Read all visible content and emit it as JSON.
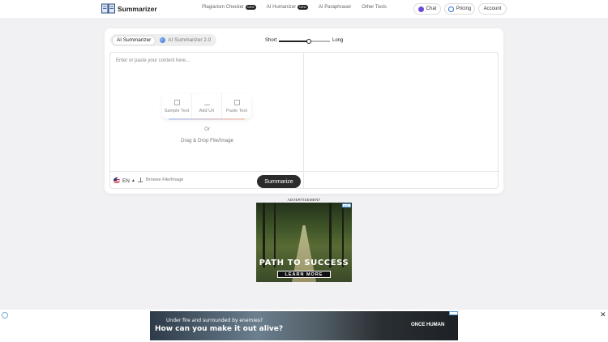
{
  "header": {
    "logo_text": "Summarizer",
    "nav": [
      {
        "label": "Plagiarism Checker",
        "badge": "NEW"
      },
      {
        "label": "AI Humanizer",
        "badge": "NEW"
      },
      {
        "label": "AI Paraphraser",
        "badge": ""
      },
      {
        "label": "Other Tools",
        "badge": ""
      }
    ],
    "chat_label": "Chat",
    "pricing_label": "Pricing",
    "account_label": "Account"
  },
  "tabs": [
    {
      "label": "AI Summarizer",
      "active": true
    },
    {
      "label": "AI Summarizer 2.0",
      "active": false
    }
  ],
  "length": {
    "short_label": "Short",
    "long_label": "Long",
    "level": 0.58
  },
  "editor": {
    "placeholder": "Enter or paste your content here...",
    "actions": [
      {
        "label": "Sample Text",
        "icon": "edit-icon"
      },
      {
        "label": "Add Url",
        "icon": "upload-icon"
      },
      {
        "label": "Paste Text",
        "icon": "clipboard-icon"
      }
    ],
    "or_text": "Or",
    "drag_text": "Drag & Drop File/Image",
    "lang": "EN",
    "browse_label": "Browse File/Image",
    "summarize_label": "Summarize"
  },
  "ad": {
    "label": "ADVERTISEMENT",
    "title": "PATH TO SUCCESS",
    "cta": "LEARN MORE"
  },
  "banner": {
    "line1": "Under fire and surrounded by enemies?",
    "line2": "How can you make it out alive?",
    "brand": "ONCE HUMAN"
  },
  "colors": {
    "primary_button": "#2b2b2b",
    "background": "#f1f1f3"
  }
}
